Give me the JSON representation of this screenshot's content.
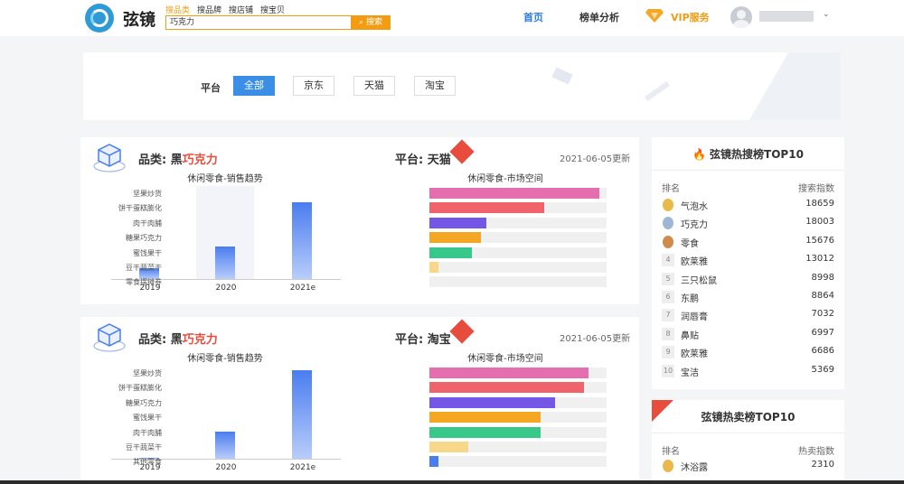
{
  "header": {
    "brand": "弦镜",
    "search_tabs": [
      "搜品类",
      "搜品牌",
      "搜店铺",
      "搜宝贝"
    ],
    "search_value": "巧克力",
    "search_button": "搜索",
    "nav_home": "首页",
    "nav_rank": "榜单分析",
    "nav_vip": "VIP服务"
  },
  "filter": {
    "label": "平台",
    "options": [
      "全部",
      "京东",
      "天猫",
      "淘宝"
    ],
    "selected": "全部"
  },
  "cards": [
    {
      "category_label": "品类:",
      "category_prefix": "黑",
      "category_highlight": "巧克力",
      "trend_title": "休闲零食-销售趋势",
      "platform_label": "平台:",
      "platform_value": "天猫",
      "date": "2021-06-05更新",
      "space_title": "休闲零食-市场空间",
      "trend_bars": [
        {
          "year": "2019",
          "value": 0.12
        },
        {
          "year": "2020",
          "value": 0.36
        },
        {
          "year": "2021e",
          "value": 0.85
        }
      ],
      "space_rows": [
        {
          "label": "坚果炒货",
          "value": 0.96,
          "color": "#e56fae"
        },
        {
          "label": "饼干蛋糕膨化",
          "value": 0.65,
          "color": "#f0636a"
        },
        {
          "label": "肉干肉脯",
          "value": 0.32,
          "color": "#7557e8"
        },
        {
          "label": "糖果巧克力",
          "value": 0.29,
          "color": "#f5a623"
        },
        {
          "label": "蜜饯果干",
          "value": 0.24,
          "color": "#38c98a"
        },
        {
          "label": "豆干蔬菜干",
          "value": 0.05,
          "color": "#f7d88a"
        },
        {
          "label": "零食摆摊券",
          "value": 0.0,
          "color": "#4a7df0"
        }
      ]
    },
    {
      "category_label": "品类:",
      "category_prefix": "黑",
      "category_highlight": "巧克力",
      "trend_title": "休闲零食-销售趋势",
      "platform_label": "平台:",
      "platform_value": "淘宝",
      "date": "2021-06-05更新",
      "space_title": "休闲零食-市场空间",
      "trend_bars": [
        {
          "year": "2019",
          "value": 0.01
        },
        {
          "year": "2020",
          "value": 0.3
        },
        {
          "year": "2021e",
          "value": 0.98
        }
      ],
      "space_rows": [
        {
          "label": "坚果炒货",
          "value": 0.9,
          "color": "#e56fae"
        },
        {
          "label": "饼干蛋糕膨化",
          "value": 0.87,
          "color": "#f0636a"
        },
        {
          "label": "糖果巧克力",
          "value": 0.71,
          "color": "#7557e8"
        },
        {
          "label": "蜜饯果干",
          "value": 0.63,
          "color": "#f5a623"
        },
        {
          "label": "肉干肉脯",
          "value": 0.63,
          "color": "#38c98a"
        },
        {
          "label": "豆干蔬菜干",
          "value": 0.22,
          "color": "#f7d88a"
        },
        {
          "label": "其他零食",
          "value": 0.05,
          "color": "#4a7df0"
        }
      ]
    }
  ],
  "hot_search": {
    "title": "弦镜热搜榜TOP10",
    "col_rank": "排名",
    "col_value": "搜索指数",
    "rows": [
      {
        "rank": "1",
        "name": "气泡水",
        "value": "18659",
        "medal": "gold"
      },
      {
        "rank": "2",
        "name": "巧克力",
        "value": "18003",
        "medal": "silver"
      },
      {
        "rank": "3",
        "name": "零食",
        "value": "15676",
        "medal": "bronze"
      },
      {
        "rank": "4",
        "name": "欧莱雅",
        "value": "13012"
      },
      {
        "rank": "5",
        "name": "三只松鼠",
        "value": "8998"
      },
      {
        "rank": "6",
        "name": "东鹏",
        "value": "8864"
      },
      {
        "rank": "7",
        "name": "润唇膏",
        "value": "7032"
      },
      {
        "rank": "8",
        "name": "鼻贴",
        "value": "6997"
      },
      {
        "rank": "9",
        "name": "欧莱雅",
        "value": "6686"
      },
      {
        "rank": "10",
        "name": "宝洁",
        "value": "5369"
      }
    ]
  },
  "hot_sell": {
    "title": "弦镜热卖榜TOP10",
    "col_rank": "排名",
    "col_value": "热卖指数",
    "rows": [
      {
        "rank": "1",
        "name": "沐浴露",
        "value": "2310",
        "medal": "gold"
      }
    ]
  },
  "colors": {
    "accent": "#3a8ee6",
    "search": "#f39c12",
    "hot": "#e74c3c"
  }
}
